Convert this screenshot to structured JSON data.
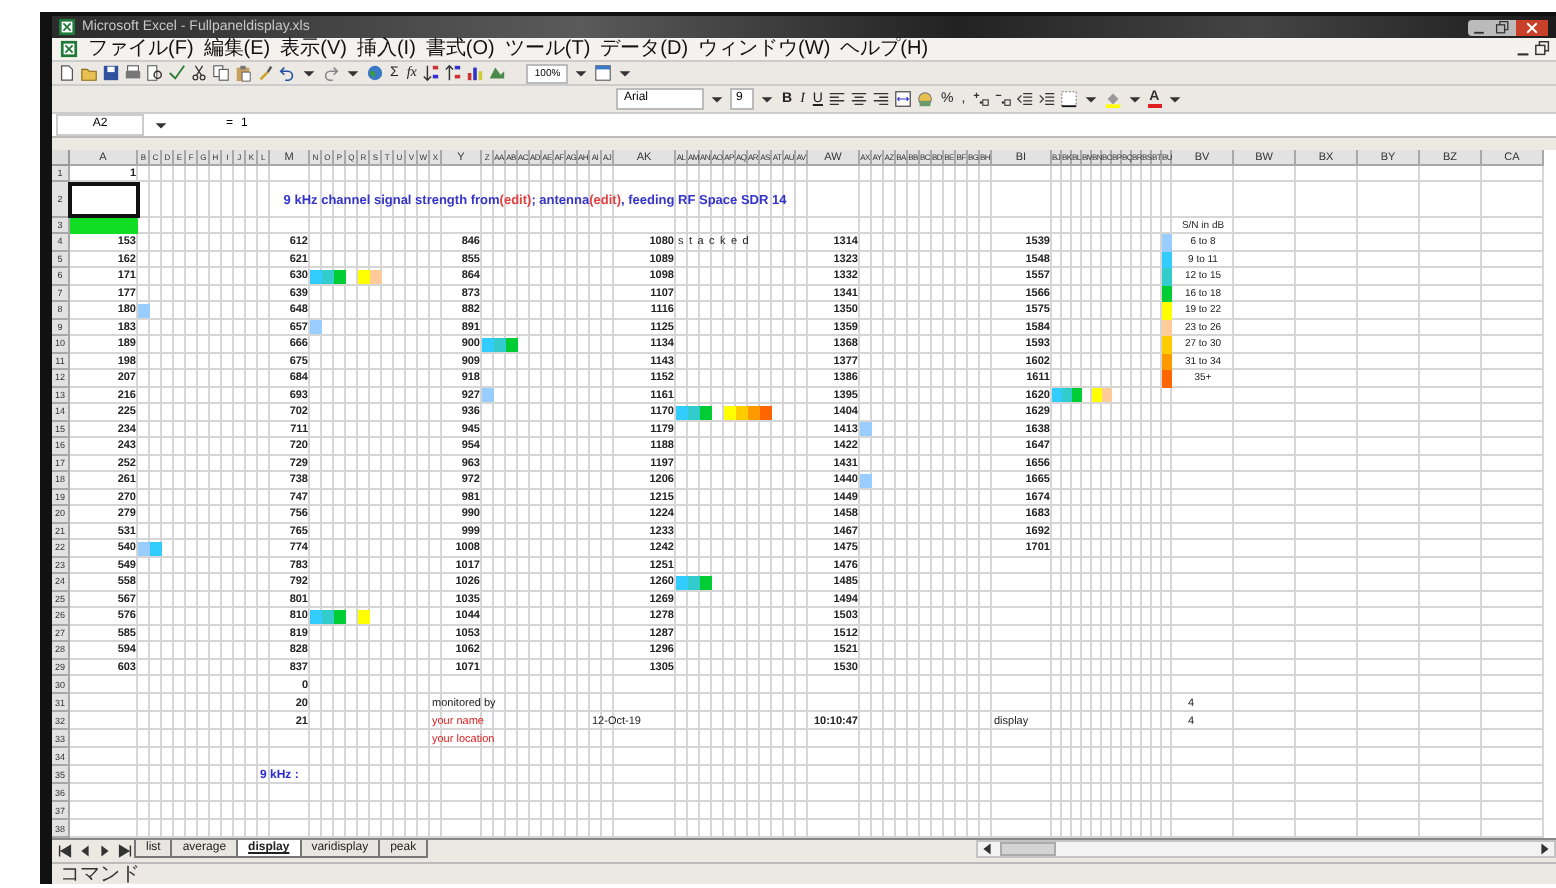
{
  "window": {
    "title": "Microsoft Excel - Fullpaneldisplay.xls"
  },
  "menu": [
    "ファイル(F)",
    "編集(E)",
    "表示(V)",
    "挿入(I)",
    "書式(O)",
    "ツール(T)",
    "データ(D)",
    "ウィンドウ(W)",
    "ヘルプ(H)"
  ],
  "toolbar": {
    "sum": "Σ",
    "function": "fx",
    "zoom": "100%"
  },
  "format_toolbar": {
    "font": "Arial",
    "size": "9",
    "bold": "B",
    "italic": "I",
    "underline": "U",
    "percent": "%",
    "comma": ",",
    "font_color": "A"
  },
  "formula_bar": {
    "name_box": "A2",
    "equals": "=",
    "formula": "1"
  },
  "sheet": {
    "columns": [
      "A",
      "B",
      "C",
      "D",
      "E",
      "F",
      "G",
      "H",
      "I",
      "J",
      "K",
      "L",
      "M",
      "N",
      "O",
      "P",
      "Q",
      "R",
      "S",
      "T",
      "U",
      "V",
      "W",
      "X",
      "Y",
      "Z",
      "AA",
      "AB",
      "AC",
      "AD",
      "AE",
      "AF",
      "AG",
      "AH",
      "AI",
      "AJ",
      "AK",
      "AL",
      "AM",
      "AN",
      "AO",
      "AP",
      "AQ",
      "AR",
      "AS",
      "AT",
      "AU",
      "AV",
      "AW",
      "AX",
      "AY",
      "AZ",
      "BA",
      "BB",
      "BC",
      "BD",
      "BE",
      "BF",
      "BG",
      "BH",
      "BI",
      "BJ",
      "BK",
      "BL",
      "BM",
      "BN",
      "BO",
      "BP",
      "BQ",
      "BR",
      "BS",
      "BT",
      "BU",
      "BV",
      "BW",
      "BX",
      "BY",
      "BZ",
      "CA"
    ],
    "row_numbers": [
      "1",
      "2",
      "3",
      "4",
      "5",
      "6",
      "7",
      "8",
      "9",
      "10",
      "11",
      "12",
      "13",
      "14",
      "15",
      "16",
      "17",
      "18",
      "19",
      "20",
      "21",
      "22",
      "23",
      "24",
      "25",
      "26",
      "27",
      "28",
      "29",
      "30",
      "31",
      "32",
      "33",
      "34",
      "35",
      "36",
      "37",
      "38"
    ],
    "a1": "1",
    "title": [
      {
        "text": "9 kHz channel signal strength from ",
        "kind": "plain"
      },
      {
        "text": "(edit)",
        "kind": "edit"
      },
      {
        "text": "; antenna ",
        "kind": "plain"
      },
      {
        "text": "(edit)",
        "kind": "edit"
      },
      {
        "text": ", feeding RF Space SDR 14",
        "kind": "plain"
      }
    ],
    "groups": [
      {
        "rows": [
          {
            "value": "153"
          },
          {
            "value": "162"
          },
          {
            "value": "171"
          },
          {
            "value": "177"
          },
          {
            "value": "180",
            "bar": [
              {
                "color": "#99ccff"
              }
            ]
          },
          {
            "value": "183"
          },
          {
            "value": "189"
          },
          {
            "value": "198"
          },
          {
            "value": "207"
          },
          {
            "value": "216"
          },
          {
            "value": "225"
          },
          {
            "value": "234"
          },
          {
            "value": "243"
          },
          {
            "value": "252"
          },
          {
            "value": "261"
          },
          {
            "value": "270"
          },
          {
            "value": "279"
          },
          {
            "value": "531"
          },
          {
            "value": "540",
            "bar": [
              {
                "color": "#99ccff"
              },
              {
                "color": "#33ccff"
              }
            ]
          },
          {
            "value": "549"
          },
          {
            "value": "558"
          },
          {
            "value": "567"
          },
          {
            "value": "576"
          },
          {
            "value": "585"
          },
          {
            "value": "594"
          },
          {
            "value": "603"
          }
        ]
      },
      {
        "rows": [
          {
            "value": "612"
          },
          {
            "value": "621"
          },
          {
            "value": "630",
            "bar": [
              {
                "color": "#33ccff"
              },
              {
                "color": "#33cccc"
              },
              {
                "color": "#00cc33"
              }
            ],
            "bar_high": [
              {
                "color": "#ffff00"
              },
              {
                "color": "#ffcc99"
              }
            ]
          },
          {
            "value": "639"
          },
          {
            "value": "648"
          },
          {
            "value": "657",
            "bar": [
              {
                "color": "#99ccff"
              }
            ]
          },
          {
            "value": "666"
          },
          {
            "value": "675"
          },
          {
            "value": "684"
          },
          {
            "value": "693"
          },
          {
            "value": "702"
          },
          {
            "value": "711"
          },
          {
            "value": "720"
          },
          {
            "value": "729"
          },
          {
            "value": "738"
          },
          {
            "value": "747"
          },
          {
            "value": "756"
          },
          {
            "value": "765"
          },
          {
            "value": "774"
          },
          {
            "value": "783"
          },
          {
            "value": "792"
          },
          {
            "value": "801"
          },
          {
            "value": "810",
            "bar": [
              {
                "color": "#33ccff"
              },
              {
                "color": "#33cccc"
              },
              {
                "color": "#00cc33"
              }
            ],
            "bar_high": [
              {
                "color": "#ffff00"
              }
            ]
          },
          {
            "value": "819"
          },
          {
            "value": "828"
          },
          {
            "value": "837"
          }
        ]
      },
      {
        "rows": [
          {
            "value": "846"
          },
          {
            "value": "855"
          },
          {
            "value": "864"
          },
          {
            "value": "873"
          },
          {
            "value": "882"
          },
          {
            "value": "891"
          },
          {
            "value": "900",
            "bar": [
              {
                "color": "#33ccff"
              },
              {
                "color": "#33cccc"
              },
              {
                "color": "#00cc33"
              }
            ]
          },
          {
            "value": "909"
          },
          {
            "value": "918"
          },
          {
            "value": "927",
            "bar": [
              {
                "color": "#99ccff"
              }
            ]
          },
          {
            "value": "936"
          },
          {
            "value": "945"
          },
          {
            "value": "954"
          },
          {
            "value": "963"
          },
          {
            "value": "972"
          },
          {
            "value": "981"
          },
          {
            "value": "990"
          },
          {
            "value": "999"
          },
          {
            "value": "1008"
          },
          {
            "value": "1017"
          },
          {
            "value": "1026"
          },
          {
            "value": "1035"
          },
          {
            "value": "1044"
          },
          {
            "value": "1053"
          },
          {
            "value": "1062"
          },
          {
            "value": "1071"
          }
        ]
      },
      {
        "rows": [
          {
            "value": "1080",
            "note": "s t a c k e d"
          },
          {
            "value": "1089"
          },
          {
            "value": "1098"
          },
          {
            "value": "1107"
          },
          {
            "value": "1116"
          },
          {
            "value": "1125"
          },
          {
            "value": "1134"
          },
          {
            "value": "1143"
          },
          {
            "value": "1152"
          },
          {
            "value": "1161"
          },
          {
            "value": "1170",
            "bar": [
              {
                "color": "#33ccff"
              },
              {
                "color": "#33cccc"
              },
              {
                "color": "#00cc33"
              }
            ],
            "bar_high": [
              {
                "color": "#ffff00"
              },
              {
                "color": "#ffcc00"
              },
              {
                "color": "#ff9900"
              },
              {
                "color": "#ff6600"
              }
            ]
          },
          {
            "value": "1179"
          },
          {
            "value": "1188"
          },
          {
            "value": "1197"
          },
          {
            "value": "1206"
          },
          {
            "value": "1215"
          },
          {
            "value": "1224"
          },
          {
            "value": "1233"
          },
          {
            "value": "1242"
          },
          {
            "value": "1251"
          },
          {
            "value": "1260",
            "bar": [
              {
                "color": "#33ccff"
              },
              {
                "color": "#33cccc"
              },
              {
                "color": "#00cc33"
              }
            ]
          },
          {
            "value": "1269"
          },
          {
            "value": "1278"
          },
          {
            "value": "1287"
          },
          {
            "value": "1296"
          },
          {
            "value": "1305"
          }
        ]
      },
      {
        "rows": [
          {
            "value": "1314"
          },
          {
            "value": "1323"
          },
          {
            "value": "1332"
          },
          {
            "value": "1341"
          },
          {
            "value": "1350"
          },
          {
            "value": "1359"
          },
          {
            "value": "1368"
          },
          {
            "value": "1377"
          },
          {
            "value": "1386"
          },
          {
            "value": "1395"
          },
          {
            "value": "1404"
          },
          {
            "value": "1413",
            "bar": [
              {
                "color": "#99ccff"
              }
            ]
          },
          {
            "value": "1422"
          },
          {
            "value": "1431"
          },
          {
            "value": "1440",
            "bar": [
              {
                "color": "#99ccff"
              }
            ]
          },
          {
            "value": "1449"
          },
          {
            "value": "1458"
          },
          {
            "value": "1467"
          },
          {
            "value": "1475"
          },
          {
            "value": "1476"
          },
          {
            "value": "1485"
          },
          {
            "value": "1494"
          },
          {
            "value": "1503"
          },
          {
            "value": "1512"
          },
          {
            "value": "1521"
          },
          {
            "value": "1530"
          }
        ]
      },
      {
        "rows": [
          {
            "value": "1539"
          },
          {
            "value": "1548"
          },
          {
            "value": "1557"
          },
          {
            "value": "1566"
          },
          {
            "value": "1575"
          },
          {
            "value": "1584"
          },
          {
            "value": "1593"
          },
          {
            "value": "1602"
          },
          {
            "value": "1611"
          },
          {
            "value": "1620",
            "bar": [
              {
                "color": "#33ccff"
              },
              {
                "color": "#33cccc"
              },
              {
                "color": "#00cc33"
              }
            ],
            "bar_high": [
              {
                "color": "#ffff00"
              },
              {
                "color": "#ffcc99"
              }
            ]
          },
          {
            "value": "1629"
          },
          {
            "value": "1638"
          },
          {
            "value": "1647"
          },
          {
            "value": "1656"
          },
          {
            "value": "1665"
          },
          {
            "value": "1674"
          },
          {
            "value": "1683"
          },
          {
            "value": "1692"
          },
          {
            "value": "1701"
          }
        ]
      }
    ],
    "legend": {
      "title": "S/N in dB",
      "items": [
        {
          "label": "6 to 8",
          "color": "#99ccff"
        },
        {
          "label": "9 to 11",
          "color": "#33ccff"
        },
        {
          "label": "12 to 15",
          "color": "#33cccc"
        },
        {
          "label": "16 to 18",
          "color": "#00cc33"
        },
        {
          "label": "19 to 22",
          "color": "#ffff00"
        },
        {
          "label": "23 to 26",
          "color": "#ffcc99"
        },
        {
          "label": "27 to 30",
          "color": "#ffcc00"
        },
        {
          "label": "31 to 34",
          "color": "#ff9900"
        },
        {
          "label": "35+",
          "color": "#ff6600"
        }
      ]
    },
    "counts": [
      "0",
      "20",
      "21"
    ],
    "monitored_by": "monitored by",
    "your_name": "your name",
    "your_location": "your location",
    "date": "12-Oct-19",
    "time": "10:10:47",
    "mode": "display",
    "flags": [
      "4",
      "4"
    ],
    "step_label": "9 kHz :"
  },
  "sheet_tabs": [
    {
      "label": "list",
      "selected": false
    },
    {
      "label": "average",
      "selected": false
    },
    {
      "label": "display",
      "selected": true
    },
    {
      "label": "varidisplay",
      "selected": false
    },
    {
      "label": "peak",
      "selected": false
    }
  ],
  "status_bar": "コマンド"
}
